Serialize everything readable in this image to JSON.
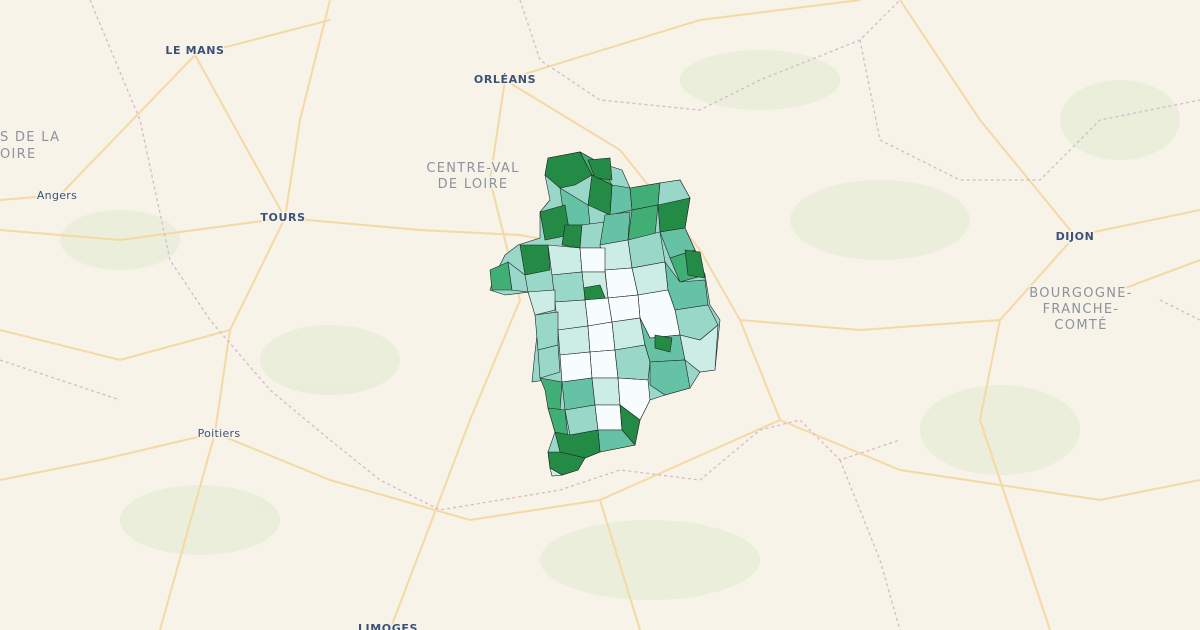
{
  "map": {
    "colors": {
      "background": "#f7f3e9",
      "road": "#f5d9a3",
      "border": "#d6b8cf",
      "forest": "#e6ecd6",
      "choropleth": [
        "#f7fcfd",
        "#ccece6",
        "#99d8c9",
        "#66c2a4",
        "#41ae76",
        "#238b45"
      ]
    },
    "labels": {
      "le_mans": "LE MANS",
      "orleans": "ORLÉANS",
      "tours": "TOURS",
      "dijon": "DIJON",
      "limoges": "LIMOGES",
      "angers": "Angers",
      "poitiers": "Poitiers",
      "pays_de_la_loire_line1": "S DE LA",
      "pays_de_la_loire_line2": "OIRE",
      "centre_line1": "CENTRE-VAL",
      "centre_line2": "DE LOIRE",
      "bourgogne_line1": "BOURGOGNE-",
      "bourgogne_line2": "FRANCHE-",
      "bourgogne_line3": "COMTÉ"
    }
  }
}
